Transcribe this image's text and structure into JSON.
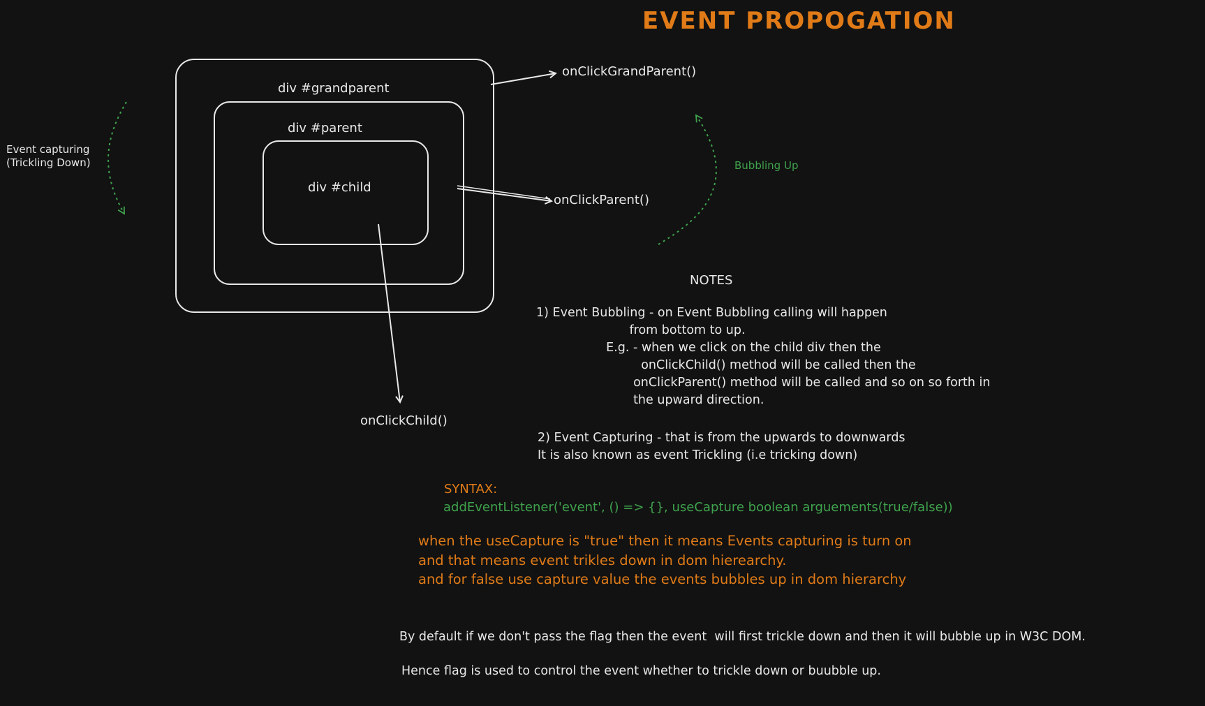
{
  "colors": {
    "background": "#121212",
    "stroke": "#e8e8e8",
    "orange": "#e07b18",
    "green": "#3fa34d"
  },
  "title": "EVENT PROPOGATION",
  "boxes": {
    "grandparent": "div #grandparent",
    "parent": "div #parent",
    "child": "div #child"
  },
  "handlers": {
    "grandparent": "onClickGrandParent()",
    "parent": "onClickParent()",
    "child": "onClickChild()"
  },
  "capturing_label": "Event capturing\n(Trickling Down)",
  "bubbling_label": "Bubbling Up",
  "notes": {
    "heading": "NOTES",
    "bubbling": "1) Event Bubbling - on Event Bubbling calling will happen\n                        from bottom to up.\n                  E.g. - when we click on the child div then the\n                           onClickChild() method will be called then the\n                         onClickParent() method will be called and so on so forth in\n                         the upward direction.",
    "capturing": "2) Event Capturing - that is from the upwards to downwards\nIt is also known as event Trickling (i.e tricking down)"
  },
  "syntax": {
    "label": "SYNTAX:",
    "code": "addEventListener('event', () => {}, useCapture boolean arguements(true/false))"
  },
  "usecapture_explanation": "when the useCapture is \"true\" then it means Events capturing is turn on\nand that means event trikles down in dom hierearchy.\nand for false use capture value the events bubbles up in dom hierarchy",
  "default_note": "By default if we don't pass the flag then the event  will first trickle down and then it will bubble up in W3C DOM.",
  "flag_note": "Hence flag is used to control the event whether to trickle down or buubble up."
}
